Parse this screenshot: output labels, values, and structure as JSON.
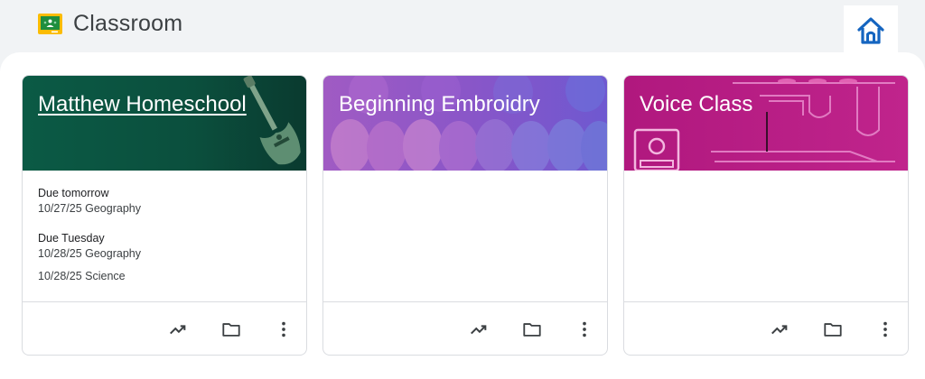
{
  "app": {
    "title": "Classroom"
  },
  "colors": {
    "accent_green": "#0d5c46",
    "embroidery_purple": "#8a56c8",
    "voice_pink": "#b0187e"
  },
  "icons": {
    "logo": "classroom-logo-icon",
    "home": "home-icon",
    "trend": "trending-up-icon",
    "folder": "folder-icon",
    "more": "more-vert-icon"
  },
  "cards": [
    {
      "title": "Matthew Homeschool",
      "due": [
        {
          "heading": "Due tomorrow",
          "items": [
            "10/27/25 Geography"
          ]
        },
        {
          "heading": "Due Tuesday",
          "items": [
            "10/28/25 Geography",
            "10/28/25 Science"
          ]
        }
      ]
    },
    {
      "title": "Beginning Embroidry",
      "due": []
    },
    {
      "title": "Voice Class",
      "due": []
    }
  ]
}
